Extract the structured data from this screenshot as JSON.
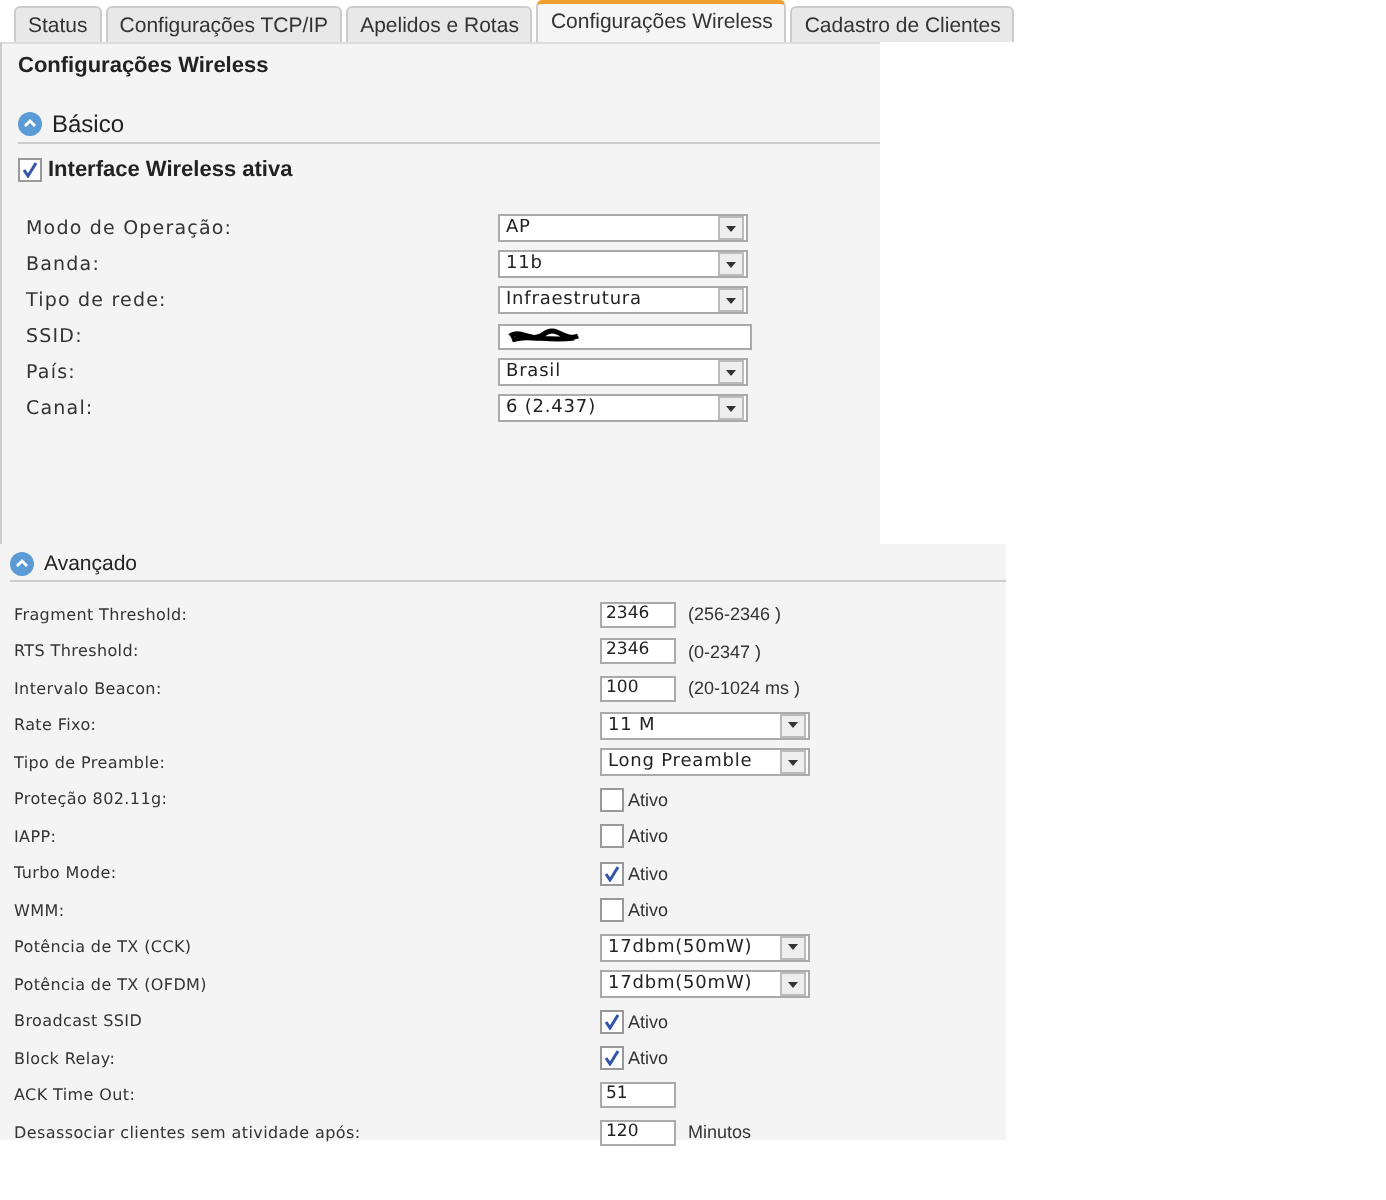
{
  "tabs": [
    {
      "label": "Status",
      "selected": false
    },
    {
      "label": "Configurações TCP/IP",
      "selected": false
    },
    {
      "label": "Apelidos e Rotas",
      "selected": false
    },
    {
      "label": "Configurações Wireless",
      "selected": true
    },
    {
      "label": "Cadastro de Clientes",
      "selected": false
    }
  ],
  "page_title": "Configurações Wireless",
  "basic": {
    "title": "Básico",
    "enable": {
      "label": "Interface Wireless ativa",
      "checked": true
    },
    "fields": [
      {
        "kind": "select",
        "label": "Modo de Operação:",
        "value": "AP"
      },
      {
        "kind": "select",
        "label": "Banda:",
        "value": "11b"
      },
      {
        "kind": "select",
        "label": "Tipo de rede:",
        "value": "Infraestrutura"
      },
      {
        "kind": "redacted",
        "label": "SSID:"
      },
      {
        "kind": "select",
        "label": "País:",
        "value": "Brasil"
      },
      {
        "kind": "select",
        "label": "Canal:",
        "value": "6 (2.437)"
      }
    ]
  },
  "advanced": {
    "title": "Avançado",
    "fields": [
      {
        "kind": "text",
        "label": "Fragment Threshold:",
        "value": "2346",
        "hint": "(256-2346 )"
      },
      {
        "kind": "text",
        "label": "RTS Threshold:",
        "value": "2346",
        "hint": "(0-2347 )"
      },
      {
        "kind": "text",
        "label": "Intervalo Beacon:",
        "value": "100",
        "hint": "(20-1024 ms )"
      },
      {
        "kind": "select",
        "label": "Rate Fixo:",
        "value": "11 M"
      },
      {
        "kind": "select",
        "label": "Tipo de Preamble:",
        "value": "Long Preamble"
      },
      {
        "kind": "checkbox",
        "label": "Proteção 802.11g:",
        "option": "Ativo",
        "checked": false
      },
      {
        "kind": "checkbox",
        "label": "IAPP:",
        "option": "Ativo",
        "checked": false
      },
      {
        "kind": "checkbox",
        "label": "Turbo Mode:",
        "option": "Ativo",
        "checked": true
      },
      {
        "kind": "checkbox",
        "label": "WMM:",
        "option": "Ativo",
        "checked": false
      },
      {
        "kind": "select",
        "label": "Potência de TX (CCK)",
        "value": "17dbm(50mW)"
      },
      {
        "kind": "select",
        "label": "Potência de TX (OFDM)",
        "value": "17dbm(50mW)"
      },
      {
        "kind": "checkbox",
        "label": "Broadcast SSID",
        "option": "Ativo",
        "checked": true
      },
      {
        "kind": "checkbox",
        "label": "Block Relay:",
        "option": "Ativo",
        "checked": true
      },
      {
        "kind": "text",
        "label": "ACK Time Out:",
        "value": "51"
      },
      {
        "kind": "text",
        "label": "Desassociar clientes sem atividade após:",
        "value": "120",
        "hint": "Minutos"
      }
    ]
  }
}
